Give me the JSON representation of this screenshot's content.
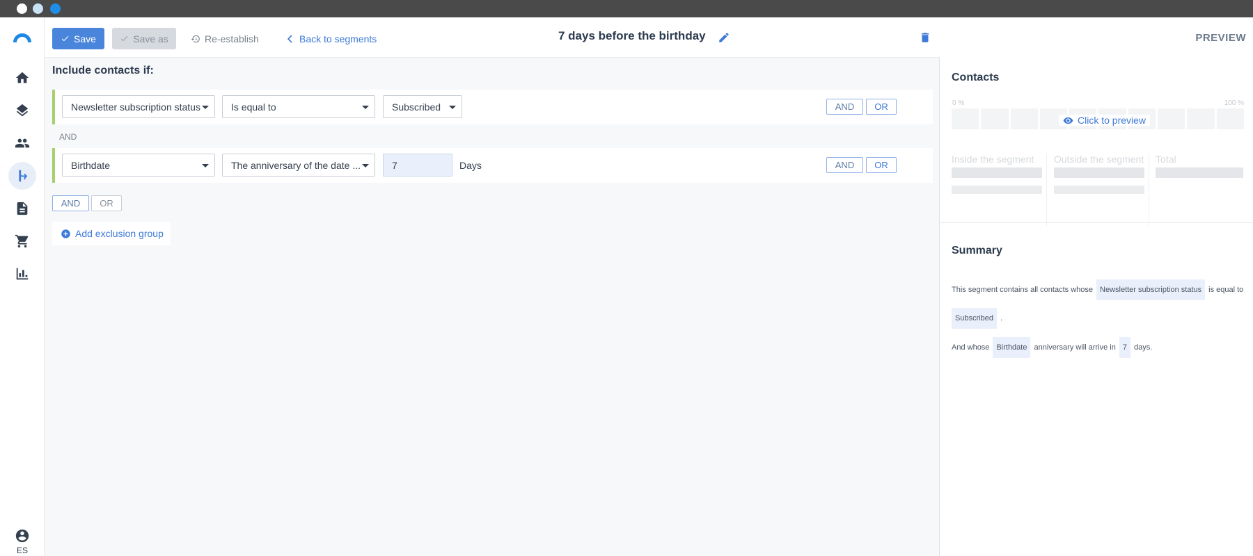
{
  "window": {
    "dots": [
      "close",
      "minimize",
      "maximize"
    ]
  },
  "sidebar": {
    "items": [
      {
        "name": "home",
        "icon": "home-icon"
      },
      {
        "name": "layers",
        "icon": "layers-icon"
      },
      {
        "name": "contacts",
        "icon": "people-icon"
      },
      {
        "name": "segments",
        "icon": "segment-icon",
        "active": true
      },
      {
        "name": "documents",
        "icon": "document-icon"
      },
      {
        "name": "cart",
        "icon": "cart-icon"
      },
      {
        "name": "reports",
        "icon": "bar-chart-icon"
      }
    ],
    "language": "ES"
  },
  "toolbar": {
    "save_label": "Save",
    "save_as_label": "Save as",
    "reestablish_label": "Re-establish",
    "back_label": "Back to segments",
    "title": "7 days before the birthday"
  },
  "builder": {
    "include_label": "Include contacts if:",
    "conditions": [
      {
        "field": "Newsletter subscription status",
        "operator": "Is equal to",
        "value": "Subscribed",
        "and_label": "AND",
        "or_label": "OR"
      },
      {
        "field": "Birthdate",
        "operator": "The anniversary of the date ...",
        "value": "7",
        "unit": "Days",
        "and_label": "AND",
        "or_label": "OR"
      }
    ],
    "separator": "AND",
    "group_and_label": "AND",
    "group_or_label": "OR",
    "add_exclusion_label": "Add exclusion group"
  },
  "preview": {
    "title": "PREVIEW",
    "contacts_heading": "Contacts",
    "pct_min": "0 %",
    "pct_max": "100 %",
    "click_to_preview": "Click to preview",
    "inside_label": "Inside the segment",
    "outside_label": "Outside the segment",
    "total_label": "Total",
    "summary_heading": "Summary",
    "summary": {
      "line1_prefix": "This segment contains all contacts whose",
      "line1_field": "Newsletter subscription status",
      "line1_op": "is equal to",
      "line2_value": "Subscribed",
      "line2_suffix": ".",
      "line3_prefix": "And whose",
      "line3_field": "Birthdate",
      "line3_mid": "anniversary will arrive in",
      "line3_value": "7",
      "line3_suffix": "days."
    }
  },
  "colors": {
    "accent": "#4a85dc",
    "condition_border": "#a9cf6e",
    "chip_bg": "#e9f0fb"
  }
}
